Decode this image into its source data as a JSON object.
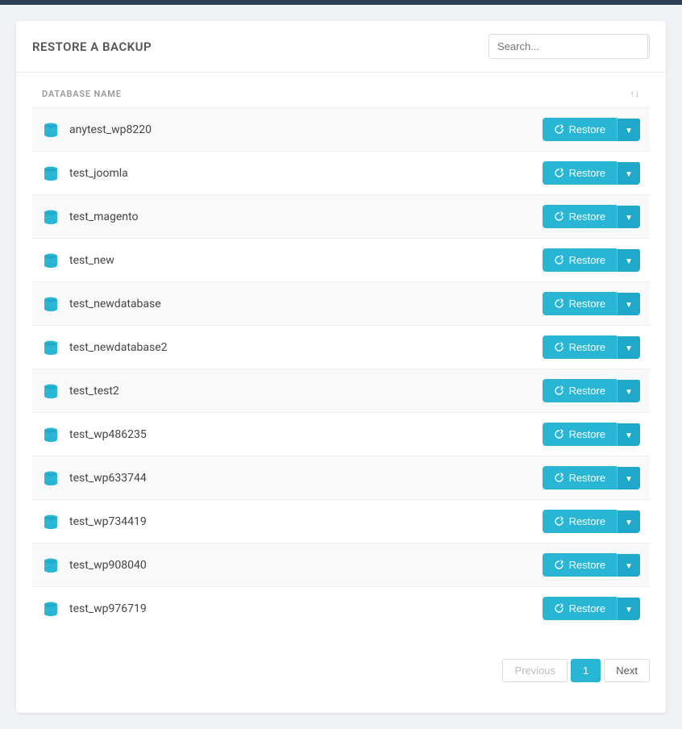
{
  "topBar": {},
  "header": {
    "title": "RESTORE A BACKUP",
    "search": {
      "placeholder": "Search..."
    }
  },
  "table": {
    "columnName": "DATABASE NAME",
    "columnSort": "↑↓",
    "rows": [
      {
        "id": 1,
        "name": "anytest_wp8220"
      },
      {
        "id": 2,
        "name": "test_joomla"
      },
      {
        "id": 3,
        "name": "test_magento"
      },
      {
        "id": 4,
        "name": "test_new"
      },
      {
        "id": 5,
        "name": "test_newdatabase"
      },
      {
        "id": 6,
        "name": "test_newdatabase2"
      },
      {
        "id": 7,
        "name": "test_test2"
      },
      {
        "id": 8,
        "name": "test_wp486235"
      },
      {
        "id": 9,
        "name": "test_wp633744"
      },
      {
        "id": 10,
        "name": "test_wp734419"
      },
      {
        "id": 11,
        "name": "test_wp908040"
      },
      {
        "id": 12,
        "name": "test_wp976719"
      }
    ],
    "restoreLabel": "Restore"
  },
  "pagination": {
    "previousLabel": "Previous",
    "currentPage": "1",
    "nextLabel": "Next"
  },
  "colors": {
    "accent": "#29b6d5",
    "topBar": "#2c3e50"
  }
}
